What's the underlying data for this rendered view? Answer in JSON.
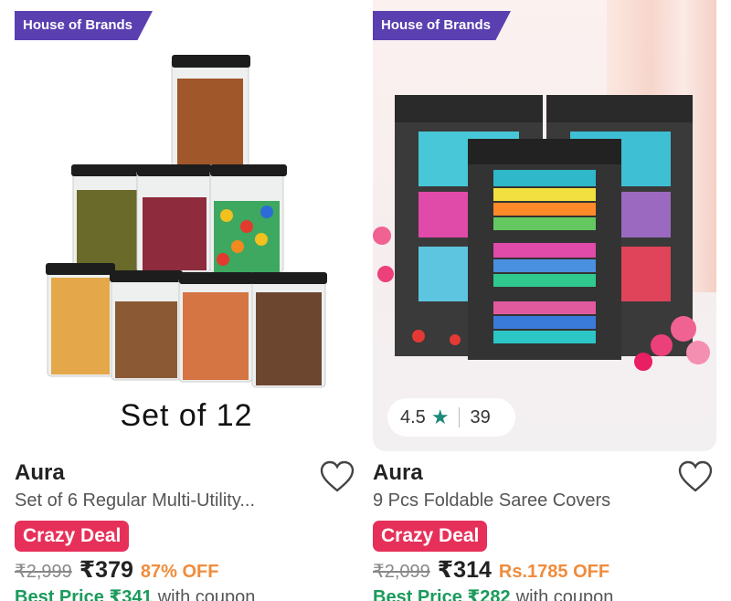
{
  "products": [
    {
      "badge": "House of Brands",
      "caption": "Set of 12",
      "brand": "Aura",
      "title": "Set of 6 Regular Multi-Utility...",
      "deal": "Crazy Deal",
      "mrp": "₹2,999",
      "price": "₹379",
      "discount": "87% OFF",
      "best_price": "Best Price ₹341",
      "coupon_text": "with coupon",
      "wishlist_icon": "heart-outline-icon"
    },
    {
      "badge": "House of Brands",
      "rating": "4.5",
      "rating_icon": "star-icon",
      "rating_count": "39",
      "brand": "Aura",
      "title": "9 Pcs Foldable Saree Covers",
      "deal": "Crazy Deal",
      "mrp": "₹2,099",
      "price": "₹314",
      "discount": "Rs.1785 OFF",
      "best_price": "Best Price ₹282",
      "coupon_text": "with coupon",
      "wishlist_icon": "heart-outline-icon"
    }
  ],
  "colors": {
    "badge_bg": "#5a3fb0",
    "deal_bg": "#e6305a",
    "discount": "#f08c3c",
    "best_price": "#1a9a5c",
    "rating_star": "#1e8a7a"
  }
}
